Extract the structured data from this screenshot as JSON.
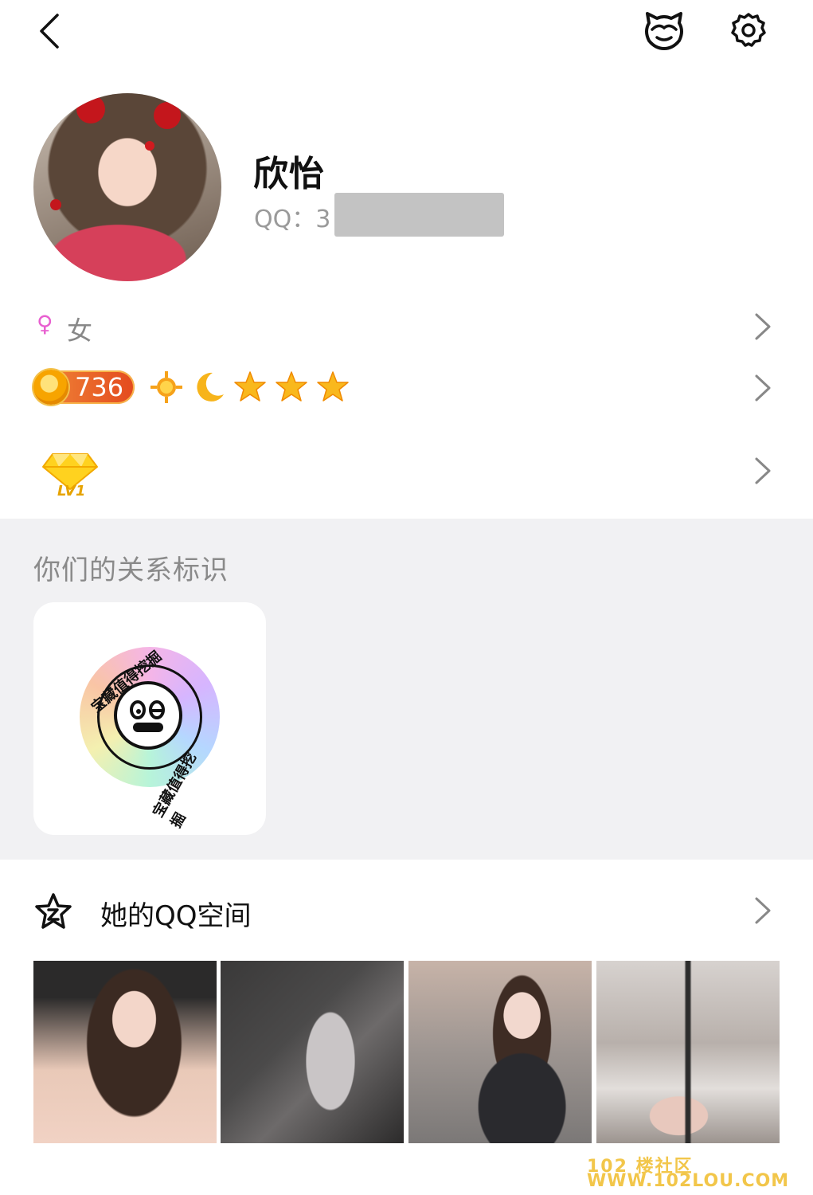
{
  "profile": {
    "name": "欣怡",
    "qq_label": "QQ：3",
    "gender_symbol": "♀",
    "gender": "女",
    "level_value": "736",
    "vip_level": "LV1"
  },
  "relation": {
    "section_title": "你们的关系标识",
    "badge_text_top": "宝藏值得挖掘",
    "badge_text_bottom": "宝藏值得挖掘"
  },
  "qzone": {
    "title": "她的QQ空间"
  },
  "watermark": {
    "line1": "102 楼社区",
    "line2": "WWW.102LOU.COM"
  },
  "icons": {
    "back": "chevron-left-icon",
    "mascot": "penguin-face-icon",
    "settings": "gear-icon",
    "chevron": "chevron-right-icon",
    "qzone": "qzone-star-icon",
    "level_icons": [
      "sun-icon",
      "moon-icon",
      "star-icon",
      "star-icon",
      "star-icon"
    ],
    "vip": "diamond-icon"
  },
  "colors": {
    "accent_orange": "#e44a1e",
    "gender_pink": "#e85fd0",
    "section_bg": "#f1f1f3",
    "star_yellow": "#f9b81d"
  }
}
